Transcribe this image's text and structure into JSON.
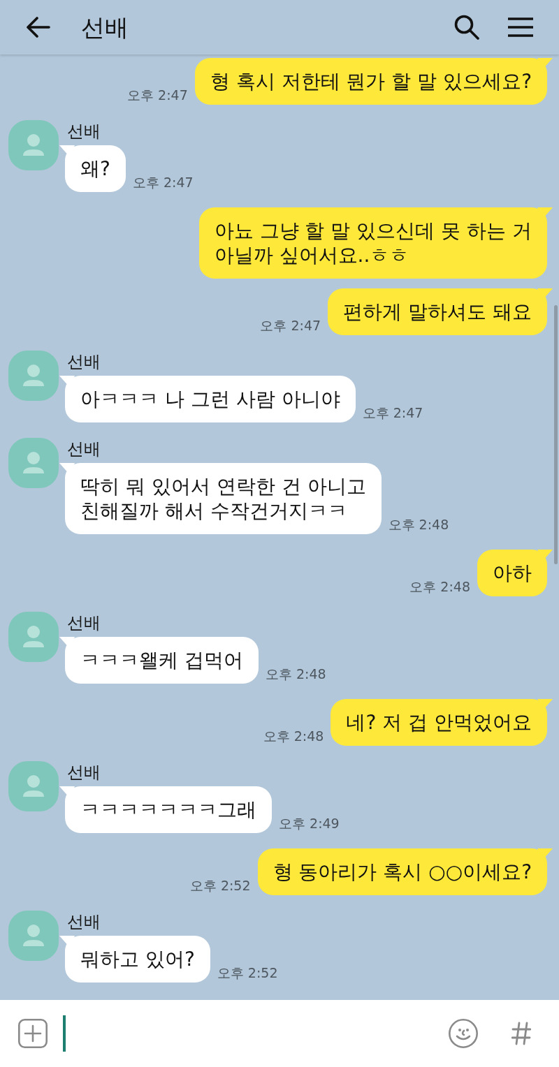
{
  "header": {
    "title": "선배"
  },
  "messages": [
    {
      "kind": "sent",
      "text": "형 혹시 저한테 뭔가 할 말 있으세요?",
      "time": "오후 2:47"
    },
    {
      "kind": "received",
      "sender": "선배",
      "text": "왜?",
      "time": "오후 2:47"
    },
    {
      "kind": "sent",
      "text": "아뇨 그냥 할 말 있으신데 못 하는 거\n아닐까 싶어서요..ㅎㅎ"
    },
    {
      "kind": "sent",
      "text": "편하게 말하셔도 돼요",
      "time": "오후 2:47"
    },
    {
      "kind": "received",
      "sender": "선배",
      "text": "아ㅋㅋㅋ 나 그런 사람 아니야",
      "time": "오후 2:47"
    },
    {
      "kind": "received",
      "sender": "선배",
      "text": "딱히 뭐 있어서 연락한 건 아니고\n친해질까 해서 수작건거지ㅋㅋ",
      "time": "오후 2:48"
    },
    {
      "kind": "sent",
      "text": "아하",
      "time": "오후 2:48"
    },
    {
      "kind": "received",
      "sender": "선배",
      "text": "ㅋㅋㅋ왤케 겁먹어",
      "time": "오후 2:48"
    },
    {
      "kind": "sent",
      "text": "네? 저 겁 안먹었어요",
      "time": "오후 2:48"
    },
    {
      "kind": "received",
      "sender": "선배",
      "text": "ㅋㅋㅋㅋㅋㅋㅋ그래",
      "time": "오후 2:49"
    },
    {
      "kind": "sent",
      "text": "형 동아리가 혹시 ○○이세요?",
      "time": "오후 2:52"
    },
    {
      "kind": "received",
      "sender": "선배",
      "text": "뭐하고 있어?",
      "time": "오후 2:52"
    }
  ],
  "input": {
    "focused": true
  }
}
